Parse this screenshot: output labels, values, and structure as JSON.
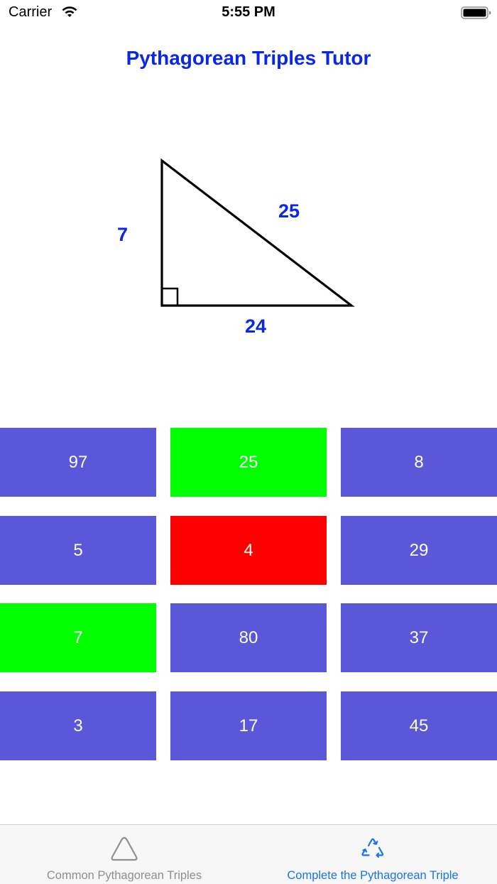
{
  "status_bar": {
    "carrier": "Carrier",
    "time": "5:55 PM",
    "icons": [
      "wifi-icon",
      "battery-icon"
    ]
  },
  "title": "Pythagorean Triples Tutor",
  "triangle": {
    "side_a": "7",
    "side_b": "24",
    "hypotenuse": "25",
    "label_color": "#0a26e8"
  },
  "grid": {
    "tiles": [
      {
        "label": "97",
        "state": "default"
      },
      {
        "label": "25",
        "state": "correct"
      },
      {
        "label": "8",
        "state": "default"
      },
      {
        "label": "5",
        "state": "default"
      },
      {
        "label": "4",
        "state": "wrong"
      },
      {
        "label": "29",
        "state": "default"
      },
      {
        "label": "7",
        "state": "correct"
      },
      {
        "label": "80",
        "state": "default"
      },
      {
        "label": "37",
        "state": "default"
      },
      {
        "label": "3",
        "state": "default"
      },
      {
        "label": "17",
        "state": "default"
      },
      {
        "label": "45",
        "state": "default"
      }
    ],
    "colors": {
      "default": "#5a57d8",
      "correct": "#00ff00",
      "wrong": "#ff0000"
    }
  },
  "tab_bar": {
    "tabs": [
      {
        "label": "Common Pythagorean Triples",
        "icon": "triangle-icon",
        "selected": false
      },
      {
        "label": "Complete the Pythagorean Triple",
        "icon": "recycle-icon",
        "selected": true
      }
    ],
    "colors": {
      "selected": "#1a73e8",
      "unselected": "#8e8e93"
    }
  }
}
